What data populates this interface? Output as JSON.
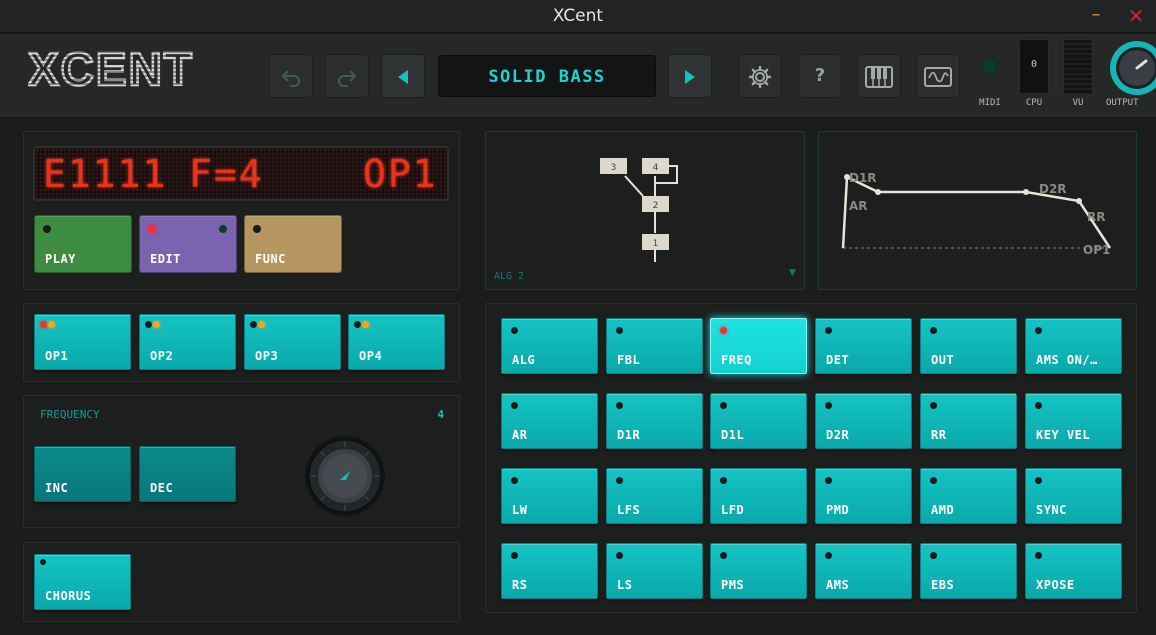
{
  "window": {
    "title": "XCent",
    "minimize": "–",
    "close": "✕"
  },
  "header": {
    "logo": "XCENT",
    "preset_name": "SOLID BASS",
    "cpu_value": "0",
    "labels": {
      "midi": "MIDI",
      "cpu": "CPU",
      "vu": "VU",
      "output": "OUTPUT"
    },
    "icons": [
      "undo-icon",
      "redo-icon",
      "prev-preset-icon",
      "next-preset-icon",
      "settings-icon",
      "help-icon",
      "keyboard-icon",
      "waveform-icon"
    ],
    "help_label": "?"
  },
  "lcd": {
    "left": "E1111",
    "middle": "F=4",
    "right": "OP1"
  },
  "modes": [
    {
      "label": "PLAY",
      "color": "#3d8c41"
    },
    {
      "label": "EDIT",
      "color": "#7b63b0"
    },
    {
      "label": "FUNC",
      "color": "#b59660"
    }
  ],
  "operators": [
    "OP1",
    "OP2",
    "OP3",
    "OP4"
  ],
  "frequency": {
    "label": "FREQUENCY",
    "value": "4",
    "inc": "INC",
    "dec": "DEC"
  },
  "chorus": "CHORUS",
  "algorithm": {
    "label": "ALG 2",
    "dropdown": "▼",
    "ops": [
      "3",
      "4",
      "2",
      "1"
    ]
  },
  "envelope": {
    "labels": {
      "d1r": "D1R",
      "ar": "AR",
      "d2r": "D2R",
      "rr": "RR",
      "op": "OP1"
    }
  },
  "params": [
    [
      "ALG",
      "FBL",
      "FREQ",
      "DET",
      "OUT",
      "AMS ON/…"
    ],
    [
      "AR",
      "D1R",
      "D1L",
      "D2R",
      "RR",
      "KEY VEL"
    ],
    [
      "LW",
      "LFS",
      "LFD",
      "PMD",
      "AMD",
      "SYNC"
    ],
    [
      "RS",
      "LS",
      "PMS",
      "AMS",
      "EBS",
      "XPOSE"
    ]
  ],
  "colors": {
    "accent": "#12c3c3",
    "teal_button": "#0fb7b9",
    "lcd": "#e9331d",
    "led_red": "#ff2b2b",
    "led_orange": "#f3a41a"
  }
}
